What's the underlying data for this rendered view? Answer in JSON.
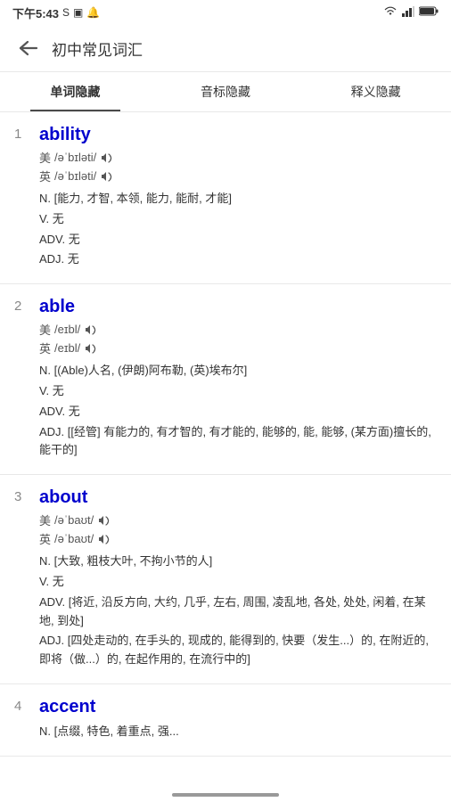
{
  "statusBar": {
    "time": "下午5:43",
    "signals": "S",
    "icons": [
      "sim",
      "notification",
      "wifi",
      "signal",
      "battery"
    ]
  },
  "header": {
    "backLabel": "←",
    "title": "初中常见词汇"
  },
  "tabs": [
    {
      "id": "word",
      "label": "单词隐藏",
      "active": true
    },
    {
      "id": "phonetic",
      "label": "音标隐藏",
      "active": false
    },
    {
      "id": "meaning",
      "label": "释义隐藏",
      "active": false
    }
  ],
  "entries": [
    {
      "number": "1",
      "word": "ability",
      "phonetics": [
        {
          "region": "美",
          "ipa": "/əˈbɪləti/",
          "sound": true
        },
        {
          "region": "英",
          "ipa": "/əˈbɪləti/",
          "sound": true
        }
      ],
      "definitions": [
        {
          "pos": "N.",
          "text": "[能力, 才智, 本领, 能力, 能耐, 才能]"
        },
        {
          "pos": "V.",
          "text": "无"
        },
        {
          "pos": "ADV.",
          "text": "无"
        },
        {
          "pos": "ADJ.",
          "text": "无"
        }
      ]
    },
    {
      "number": "2",
      "word": "able",
      "phonetics": [
        {
          "region": "美",
          "ipa": "/eɪbl/",
          "sound": true
        },
        {
          "region": "英",
          "ipa": "/eɪbl/",
          "sound": true
        }
      ],
      "definitions": [
        {
          "pos": "N.",
          "text": "[(Able)人名, (伊朗)阿布勒, (英)埃布尔]"
        },
        {
          "pos": "V.",
          "text": "无"
        },
        {
          "pos": "ADV.",
          "text": "无"
        },
        {
          "pos": "ADJ.",
          "text": "[[经管] 有能力的, 有才智的, 有才能的, 能够的, 能, 能够, (某方面)擅长的, 能干的]"
        }
      ]
    },
    {
      "number": "3",
      "word": "about",
      "phonetics": [
        {
          "region": "美",
          "ipa": "/əˈbaʊt/",
          "sound": true
        },
        {
          "region": "英",
          "ipa": "/əˈbaʊt/",
          "sound": true
        }
      ],
      "definitions": [
        {
          "pos": "N.",
          "text": "[大致, 粗枝大叶, 不拘小节的人]"
        },
        {
          "pos": "V.",
          "text": "无"
        },
        {
          "pos": "ADV.",
          "text": "[将近, 沿反方向, 大约, 几乎, 左右, 周围, 凌乱地, 各处, 处处, 闲着, 在某地, 到处]"
        },
        {
          "pos": "ADJ.",
          "text": "[四处走动的, 在手头的, 现成的, 能得到的, 快要（发生...）的, 在附近的, 即将（做...）的, 在起作用的, 在流行中的]"
        }
      ]
    },
    {
      "number": "4",
      "word": "accent",
      "phonetics": [],
      "definitions": [
        {
          "pos": "N.",
          "text": "[点缀, 特色, 着重点, 强..."
        }
      ]
    }
  ]
}
